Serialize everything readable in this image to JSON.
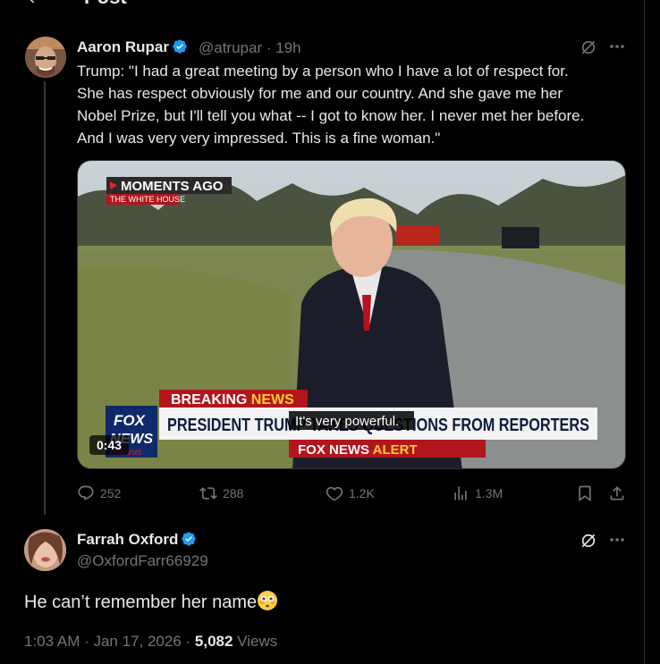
{
  "header": {
    "title": "Post"
  },
  "tweet1": {
    "name": "Aaron Rupar",
    "handle": "@atrupar · 19h",
    "text": "Trump: \"I had a great meeting by a person who I have a lot of respect for.\nShe has respect obviously for me and our country. And she gave me her\nNobel Prize, but I'll tell you what -- I got to know her. I never met her before.\nAnd I was very very impressed. This is a fine woman.\"",
    "media": {
      "badge_top": "MOMENTS AGO",
      "badge_sub": "THE WHITE HOUSE",
      "breaking_label": "BREAKING",
      "breaking_label2": "NEWS",
      "chyron": "PRESIDENT TRUMP TAKES QUESTIONS FROM REPORTERS",
      "caption": "It's very powerful.",
      "alert_a": "FOX NEWS",
      "alert_b": "ALERT",
      "logo_top": "FOX",
      "logo_mid": "NEWS",
      "logo_bottom": "channel",
      "duration": "0:43"
    },
    "stats": {
      "replies": "252",
      "reposts": "288",
      "likes": "1.2K",
      "views": "1.3M"
    }
  },
  "tweet2": {
    "name": "Farrah Oxford",
    "handle": "@OxfordFarr66929",
    "text": "He can’t remember her name",
    "emoji": "flushed-face",
    "time": "1:03 AM · Jan 17, 2026 · ",
    "views_count": "5,082",
    "views_label": " Views"
  },
  "colors": {
    "accent": "#1d9bf0",
    "muted": "#71767b",
    "text": "#e7e9ea",
    "background": "#000000",
    "border": "#2f3336"
  }
}
